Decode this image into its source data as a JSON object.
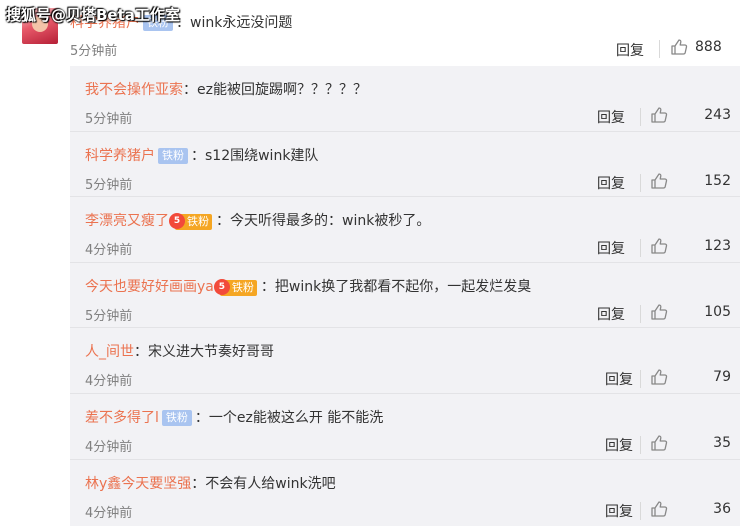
{
  "watermark": "搜狐号@贝塔Beta工作室",
  "top": {
    "username": "科学养猪户",
    "badge": "铁粉",
    "text": "：wink永远没问题",
    "time": "5分钟前",
    "reply_label": "回复",
    "likes": "888"
  },
  "replies": [
    {
      "username": "我不会操作亚索",
      "badge": "",
      "badge_type": "none",
      "text": "：ez能被回旋踢啊？？？？？",
      "time": "5分钟前",
      "reply_label": "回复",
      "likes": "243"
    },
    {
      "username": "科学养猪户",
      "badge": "铁粉",
      "badge_type": "blue",
      "text": "：s12围绕wink建队",
      "time": "5分钟前",
      "reply_label": "回复",
      "likes": "152"
    },
    {
      "username": "李漂亮又瘦了",
      "badge": "铁粉",
      "badge_type": "gold",
      "badge_icon": "5",
      "text": "：今天听得最多的：wink被秒了。",
      "time": "4分钟前",
      "reply_label": "回复",
      "likes": "123"
    },
    {
      "username": "今天也要好好画画ya",
      "badge": "铁粉",
      "badge_type": "gold",
      "badge_icon": "5",
      "text": "：把wink换了我都看不起你，一起发烂发臭",
      "time": "5分钟前",
      "reply_label": "回复",
      "likes": "105"
    },
    {
      "username": "人_间世",
      "badge": "",
      "badge_type": "none",
      "text": "：宋义进大节奏好哥哥",
      "time": "4分钟前",
      "reply_label": "回复",
      "likes": "79"
    },
    {
      "username": "差不多得了l",
      "badge": "铁粉",
      "badge_type": "blue",
      "text": "：一个ez能被这么开 能不能洗",
      "time": "4分钟前",
      "reply_label": "回复",
      "likes": "35"
    },
    {
      "username": "林y鑫今天要坚强",
      "badge": "",
      "badge_type": "none",
      "text": "：不会有人给wink洗吧",
      "time": "4分钟前",
      "reply_label": "回复",
      "likes": "36"
    }
  ],
  "colors": {
    "username": "#eb7350",
    "badge_blue": "#a9c4f0",
    "badge_gold": "#f5a623",
    "reply_bg": "#f2f2f5"
  },
  "icons": {
    "like": "thumbs-up-icon"
  }
}
